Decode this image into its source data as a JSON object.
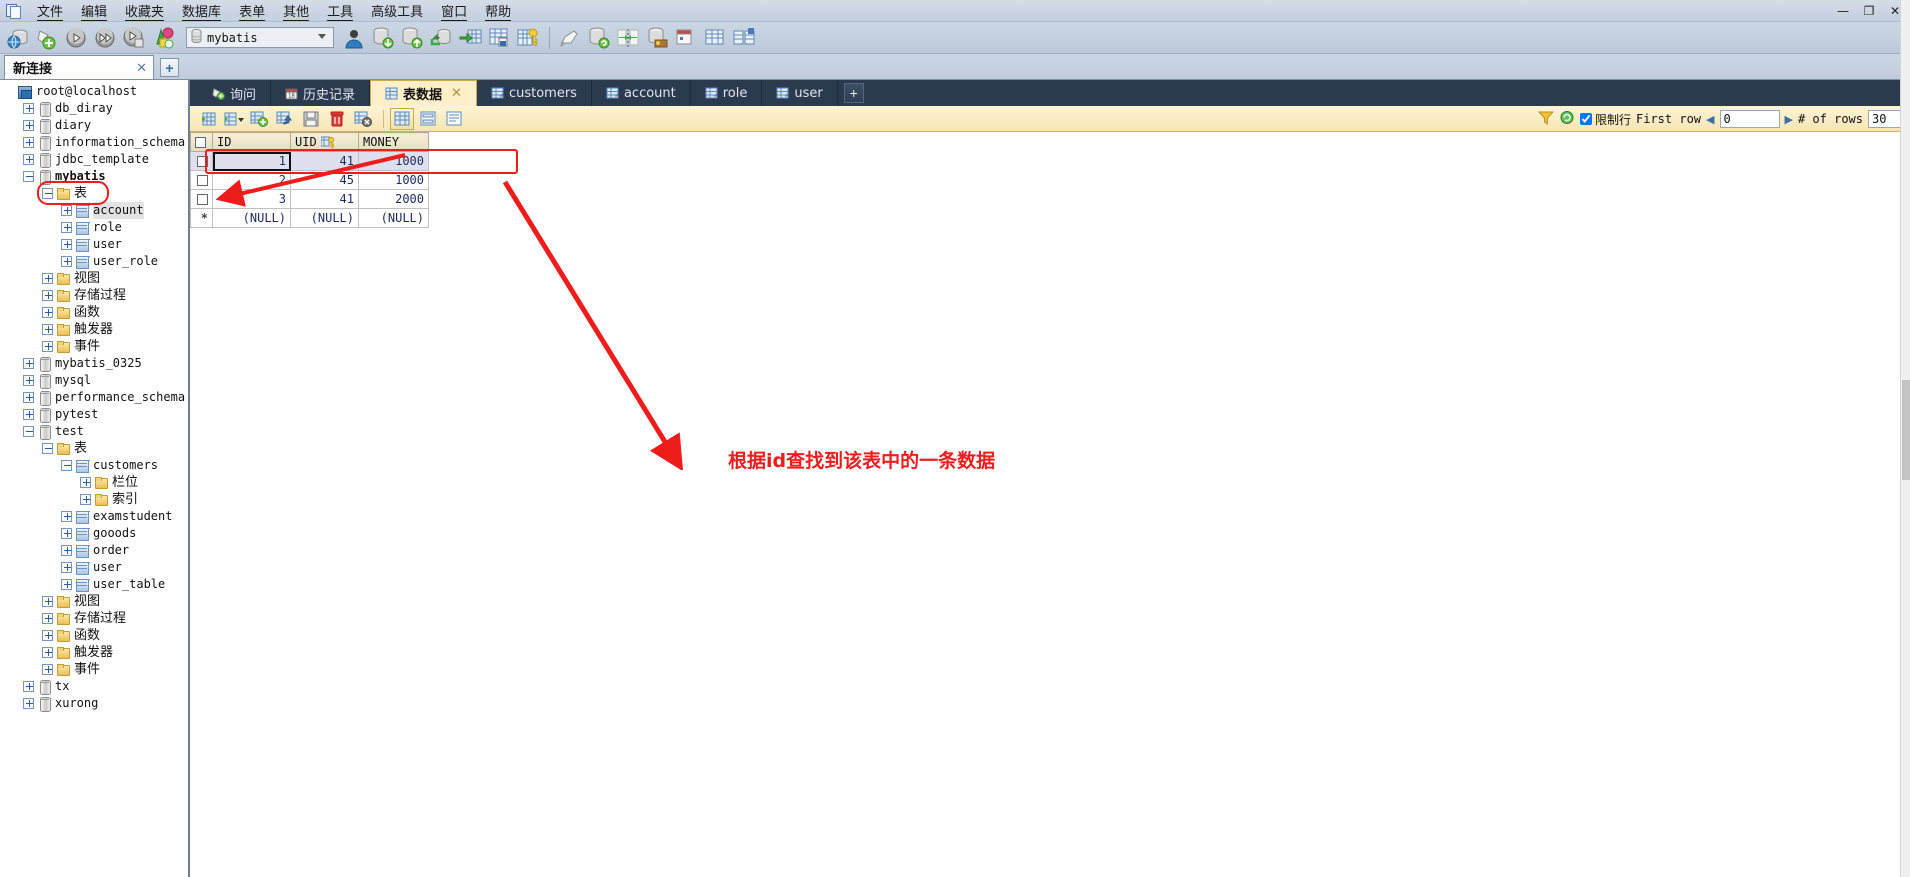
{
  "menubar": {
    "app_icon": "windows-icon",
    "items": [
      {
        "label": "文件",
        "mnemonic": "文"
      },
      {
        "label": "编辑",
        "mnemonic": "编"
      },
      {
        "label": "收藏夹",
        "mnemonic": "收"
      },
      {
        "label": "数据库",
        "mnemonic": "数据库"
      },
      {
        "label": "表单",
        "mnemonic": "表单"
      },
      {
        "label": "其他",
        "mnemonic": "其"
      },
      {
        "label": "工具",
        "mnemonic": "工具"
      },
      {
        "label": "高级工具",
        "mnemonic": "高"
      },
      {
        "label": "窗口",
        "mnemonic": "窗"
      },
      {
        "label": "帮助",
        "mnemonic": "帮"
      }
    ],
    "window_controls": {
      "minimize": "—",
      "maximize": "❐",
      "close": "✕"
    }
  },
  "toolbar": {
    "buttons": [
      {
        "name": "connection-icon",
        "title": "连接"
      },
      {
        "name": "new-query-icon",
        "title": "新建查询"
      },
      {
        "name": "run-icon",
        "title": "运行"
      },
      {
        "name": "run-all-icon",
        "title": "全部运行"
      },
      {
        "name": "stop-icon",
        "title": "停止"
      },
      {
        "name": "model-icon",
        "title": "模型"
      },
      {
        "name": "user-icon",
        "title": "用户"
      },
      {
        "name": "backup-icon",
        "title": "备份"
      },
      {
        "name": "restore-icon",
        "title": "还原"
      },
      {
        "name": "import-icon",
        "title": "导入"
      },
      {
        "name": "export-icon",
        "title": "导出"
      },
      {
        "name": "report-icon",
        "title": "报表"
      },
      {
        "name": "query-key-icon",
        "title": "查询"
      },
      {
        "name": "design-icon",
        "title": "设计"
      },
      {
        "name": "refresh-db-icon",
        "title": "刷新"
      },
      {
        "name": "sync-icon",
        "title": "同步"
      },
      {
        "name": "privileges-icon",
        "title": "权限"
      },
      {
        "name": "schedule-icon",
        "title": "计划"
      },
      {
        "name": "table-grid-icon",
        "title": "表格"
      },
      {
        "name": "compare-icon",
        "title": "比较"
      }
    ],
    "database_select": {
      "icon": "database-icon",
      "value": "mybatis",
      "chevron": "chevron-down-icon"
    }
  },
  "connection_tabs": {
    "tabs": [
      {
        "label": "新连接",
        "close": "✕",
        "active": true
      }
    ],
    "add_label": "+"
  },
  "tree": {
    "nodes": [
      {
        "depth": 0,
        "expander": "none",
        "icon": "server-icon",
        "label": "root@localhost",
        "cjk": false,
        "bold": false
      },
      {
        "depth": 1,
        "expander": "plus",
        "icon": "db-icon",
        "label": "db_diray",
        "cjk": false,
        "bold": false
      },
      {
        "depth": 1,
        "expander": "plus",
        "icon": "db-icon",
        "label": "diary",
        "cjk": false,
        "bold": false
      },
      {
        "depth": 1,
        "expander": "plus",
        "icon": "db-icon",
        "label": "information_schema",
        "cjk": false,
        "bold": false
      },
      {
        "depth": 1,
        "expander": "plus",
        "icon": "db-icon",
        "label": "jdbc_template",
        "cjk": false,
        "bold": false
      },
      {
        "depth": 1,
        "expander": "minus",
        "icon": "db-icon",
        "label": "mybatis",
        "cjk": false,
        "bold": true
      },
      {
        "depth": 2,
        "expander": "minus",
        "icon": "folder-icon",
        "label": "表",
        "cjk": true,
        "bold": false,
        "highlight_box": true
      },
      {
        "depth": 3,
        "expander": "plus",
        "icon": "table-icon",
        "label": "account",
        "cjk": false,
        "bold": false,
        "selected": true
      },
      {
        "depth": 3,
        "expander": "plus",
        "icon": "table-icon",
        "label": "role",
        "cjk": false,
        "bold": false
      },
      {
        "depth": 3,
        "expander": "plus",
        "icon": "table-icon",
        "label": "user",
        "cjk": false,
        "bold": false
      },
      {
        "depth": 3,
        "expander": "plus",
        "icon": "table-icon",
        "label": "user_role",
        "cjk": false,
        "bold": false
      },
      {
        "depth": 2,
        "expander": "plus",
        "icon": "folder-icon",
        "label": "视图",
        "cjk": true,
        "bold": false
      },
      {
        "depth": 2,
        "expander": "plus",
        "icon": "folder-icon",
        "label": "存储过程",
        "cjk": true,
        "bold": false
      },
      {
        "depth": 2,
        "expander": "plus",
        "icon": "folder-icon",
        "label": "函数",
        "cjk": true,
        "bold": false
      },
      {
        "depth": 2,
        "expander": "plus",
        "icon": "folder-icon",
        "label": "触发器",
        "cjk": true,
        "bold": false
      },
      {
        "depth": 2,
        "expander": "plus",
        "icon": "folder-icon",
        "label": "事件",
        "cjk": true,
        "bold": false
      },
      {
        "depth": 1,
        "expander": "plus",
        "icon": "db-icon",
        "label": "mybatis_0325",
        "cjk": false,
        "bold": false
      },
      {
        "depth": 1,
        "expander": "plus",
        "icon": "db-icon",
        "label": "mysql",
        "cjk": false,
        "bold": false
      },
      {
        "depth": 1,
        "expander": "plus",
        "icon": "db-icon",
        "label": "performance_schema",
        "cjk": false,
        "bold": false
      },
      {
        "depth": 1,
        "expander": "plus",
        "icon": "db-icon",
        "label": "pytest",
        "cjk": false,
        "bold": false
      },
      {
        "depth": 1,
        "expander": "minus",
        "icon": "db-icon",
        "label": "test",
        "cjk": false,
        "bold": false
      },
      {
        "depth": 2,
        "expander": "minus",
        "icon": "folder-icon",
        "label": "表",
        "cjk": true,
        "bold": false
      },
      {
        "depth": 3,
        "expander": "minus",
        "icon": "table-icon",
        "label": "customers",
        "cjk": false,
        "bold": false
      },
      {
        "depth": 4,
        "expander": "plus",
        "icon": "folder-icon",
        "label": "栏位",
        "cjk": true,
        "bold": false
      },
      {
        "depth": 4,
        "expander": "plus",
        "icon": "folder-icon",
        "label": "索引",
        "cjk": true,
        "bold": false
      },
      {
        "depth": 3,
        "expander": "plus",
        "icon": "table-icon",
        "label": "examstudent",
        "cjk": false,
        "bold": false
      },
      {
        "depth": 3,
        "expander": "plus",
        "icon": "table-icon",
        "label": "gooods",
        "cjk": false,
        "bold": false
      },
      {
        "depth": 3,
        "expander": "plus",
        "icon": "table-icon",
        "label": "order",
        "cjk": false,
        "bold": false
      },
      {
        "depth": 3,
        "expander": "plus",
        "icon": "table-icon",
        "label": "user",
        "cjk": false,
        "bold": false
      },
      {
        "depth": 3,
        "expander": "plus",
        "icon": "table-icon",
        "label": "user_table",
        "cjk": false,
        "bold": false
      },
      {
        "depth": 2,
        "expander": "plus",
        "icon": "folder-icon",
        "label": "视图",
        "cjk": true,
        "bold": false
      },
      {
        "depth": 2,
        "expander": "plus",
        "icon": "folder-icon",
        "label": "存储过程",
        "cjk": true,
        "bold": false
      },
      {
        "depth": 2,
        "expander": "plus",
        "icon": "folder-icon",
        "label": "函数",
        "cjk": true,
        "bold": false
      },
      {
        "depth": 2,
        "expander": "plus",
        "icon": "folder-icon",
        "label": "触发器",
        "cjk": true,
        "bold": false
      },
      {
        "depth": 2,
        "expander": "plus",
        "icon": "folder-icon",
        "label": "事件",
        "cjk": true,
        "bold": false
      },
      {
        "depth": 1,
        "expander": "plus",
        "icon": "db-icon",
        "label": "tx",
        "cjk": false,
        "bold": false
      },
      {
        "depth": 1,
        "expander": "plus",
        "icon": "db-icon",
        "label": "xurong",
        "cjk": false,
        "bold": false
      }
    ]
  },
  "doc_tabs": {
    "tabs": [
      {
        "label": "询问",
        "icon": "query-icon",
        "active": false,
        "closable": false
      },
      {
        "label": "历史记录",
        "icon": "history-icon",
        "active": false,
        "closable": false
      },
      {
        "label": "表数据",
        "icon": "table-data-icon",
        "active": true,
        "closable": true,
        "close": "✕"
      },
      {
        "label": "customers",
        "icon": "table-design-icon",
        "active": false,
        "closable": false
      },
      {
        "label": "account",
        "icon": "table-design-icon",
        "active": false,
        "closable": false
      },
      {
        "label": "role",
        "icon": "table-design-icon",
        "active": false,
        "closable": false
      },
      {
        "label": "user",
        "icon": "table-design-icon",
        "active": false,
        "closable": false
      }
    ],
    "add_label": "+"
  },
  "grid_toolbar": {
    "buttons": [
      {
        "name": "apply-filter-icon"
      },
      {
        "name": "sort-icon"
      },
      {
        "name": "add-record-icon"
      },
      {
        "name": "duplicate-record-icon"
      },
      {
        "name": "save-record-icon"
      },
      {
        "name": "delete-record-icon"
      },
      {
        "name": "cancel-record-icon"
      },
      {
        "name": "grid-view-icon",
        "active": true
      },
      {
        "name": "form-view-icon",
        "active": false
      },
      {
        "name": "text-view-icon",
        "active": false
      }
    ],
    "right": {
      "filter_icon": "filter-icon",
      "refresh_icon": "refresh-icon",
      "limit_checked": true,
      "limit_label": "限制行",
      "first_row_label": "First row",
      "first_row_value": "0",
      "prev_arrow": "◀",
      "next_arrow": "▶",
      "num_rows_label": "# of rows",
      "num_rows_value": "30"
    }
  },
  "data_grid": {
    "columns": [
      {
        "name": "ID",
        "key": false
      },
      {
        "name": "UID",
        "key": true,
        "key_icon": "key-icon"
      },
      {
        "name": "MONEY",
        "key": false
      }
    ],
    "rows": [
      {
        "marker": "checkbox",
        "selected": true,
        "current_cell": 0,
        "cells": [
          "1",
          "41",
          "1000"
        ]
      },
      {
        "marker": "checkbox",
        "selected": false,
        "cells": [
          "2",
          "45",
          "1000"
        ]
      },
      {
        "marker": "checkbox",
        "selected": false,
        "cells": [
          "3",
          "41",
          "2000"
        ]
      },
      {
        "marker": "*",
        "selected": false,
        "cells": [
          "(NULL)",
          "(NULL)",
          "(NULL)"
        ]
      }
    ]
  },
  "annotation": {
    "text": "根据id查找到该表中的一条数据",
    "color": "#ef1c1c"
  }
}
